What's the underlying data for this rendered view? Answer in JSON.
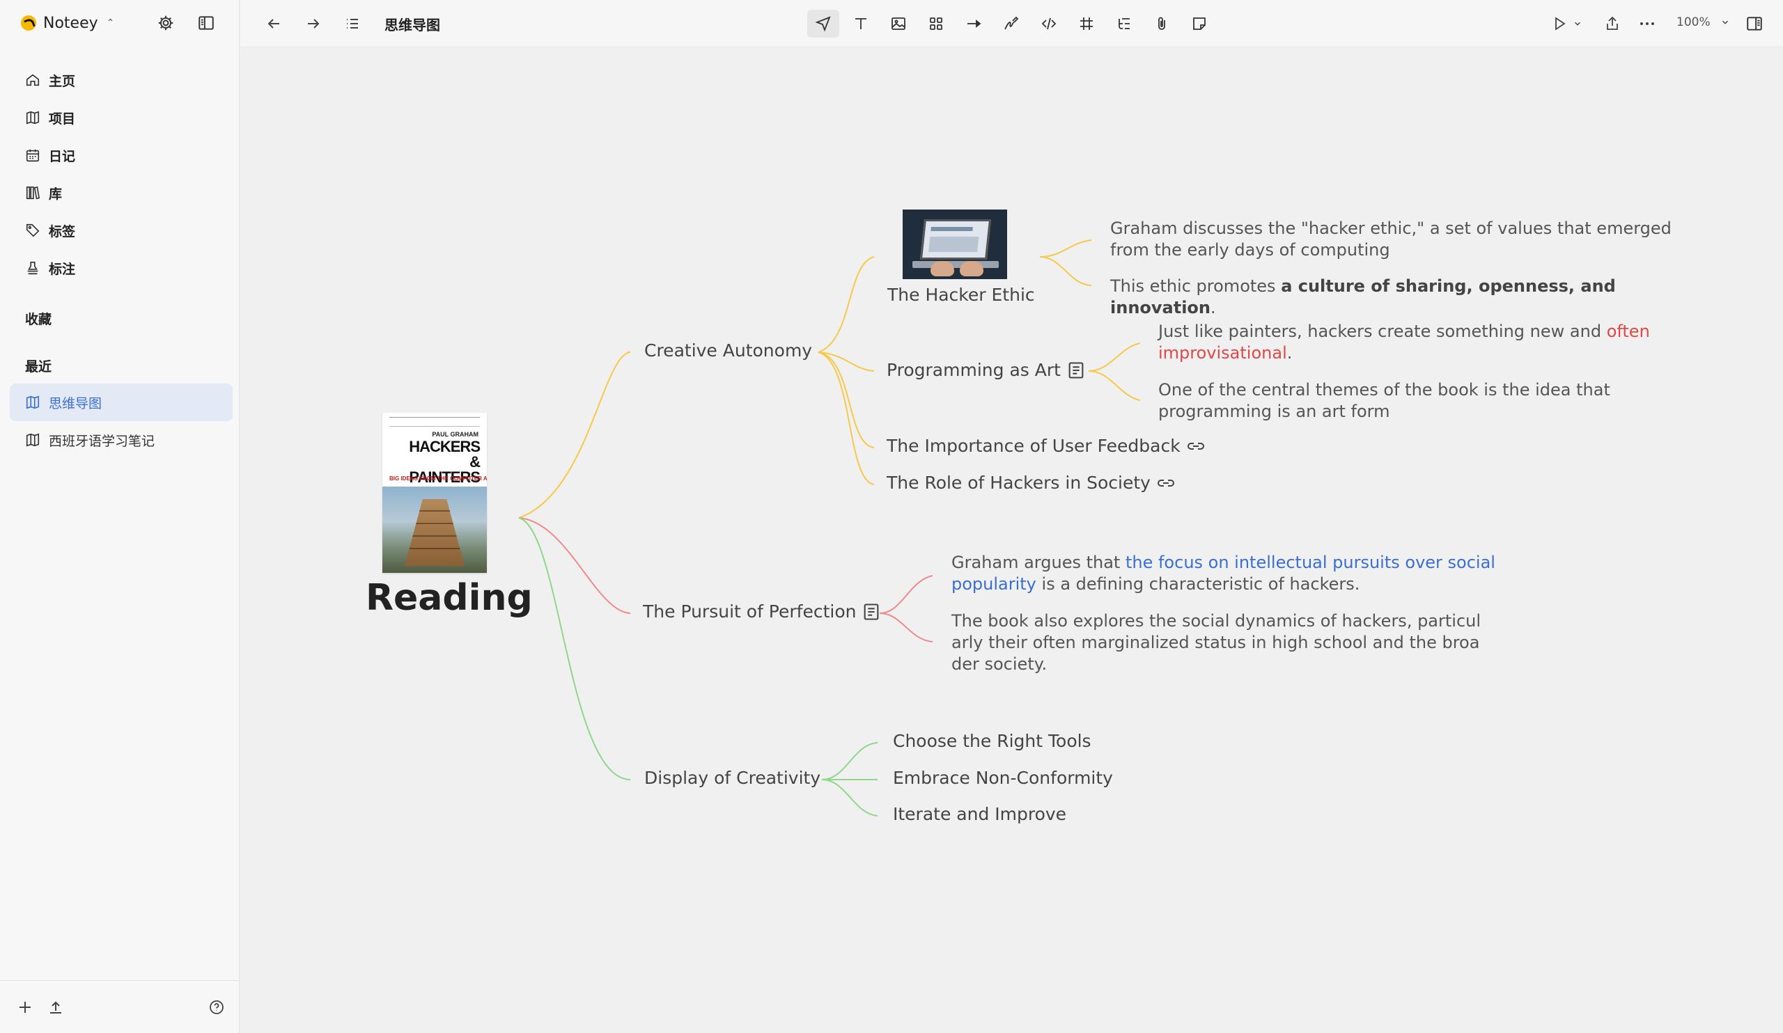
{
  "app": {
    "name": "Noteey"
  },
  "sidebar": {
    "nav": [
      {
        "label": "主页",
        "icon": "home-icon"
      },
      {
        "label": "项目",
        "icon": "map-icon"
      },
      {
        "label": "日记",
        "icon": "calendar-icon"
      },
      {
        "label": "库",
        "icon": "library-icon"
      },
      {
        "label": "标签",
        "icon": "tag-icon"
      },
      {
        "label": "标注",
        "icon": "stamp-icon"
      }
    ],
    "favorites_label": "收藏",
    "recent_label": "最近",
    "recent": [
      {
        "label": "思维导图",
        "icon": "map-icon",
        "active": true
      },
      {
        "label": "西班牙语学习笔记",
        "icon": "map-icon",
        "active": false
      }
    ]
  },
  "toolbar": {
    "doc_title": "思维导图",
    "zoom": "100%",
    "tools": [
      "select-tool",
      "text-tool",
      "image-tool",
      "widgets-tool",
      "arrow-tool",
      "pen-tool",
      "code-tool",
      "frame-tool",
      "outline-tool",
      "attachment-tool",
      "sticky-note-tool"
    ]
  },
  "mindmap": {
    "root": "Reading",
    "book": {
      "author": "PAUL GRAHAM",
      "title": "HACKERS & PAINTERS",
      "subtitle": "BIG IDEAS FROM THE COMPUTER AGE"
    },
    "colors": {
      "yellow": "#f5c94a",
      "red": "#f08a8a",
      "green": "#8fd88a"
    },
    "creative_autonomy": {
      "label": "Creative Autonomy",
      "hacker_ethic": {
        "label": "The Hacker Ethic",
        "note1": "Graham discusses the \"hacker ethic,\" a set of values that emerged from the early days of computing",
        "note2_pre": "This ethic promotes ",
        "note2_bold": "a culture of sharing, openness, and innovation",
        "note2_post": "."
      },
      "programming_art": {
        "label": "Programming as Art",
        "note1_pre": "Just like painters, hackers create something new and ",
        "note1_red": "often improvisational",
        "note1_post": ".",
        "note2": "One of the central themes of the book is the idea that programming is an art form"
      },
      "user_feedback": "The Importance of User Feedback",
      "role_hackers": "The Role of Hackers in Society"
    },
    "pursuit": {
      "label": "The Pursuit of Perfection",
      "note1_pre": "Graham argues that ",
      "note1_blue": "the focus on intellectual pursuits over social popularity",
      "note1_post": " is a defining characteristic of hackers.",
      "note2": "The book also explores the social dynamics of hackers, particularly their often marginalized status in high school and the broader society."
    },
    "display": {
      "label": "Display of Creativity",
      "children": [
        "Choose the Right Tools",
        "Embrace Non-Conformity",
        "Iterate and Improve"
      ]
    }
  }
}
